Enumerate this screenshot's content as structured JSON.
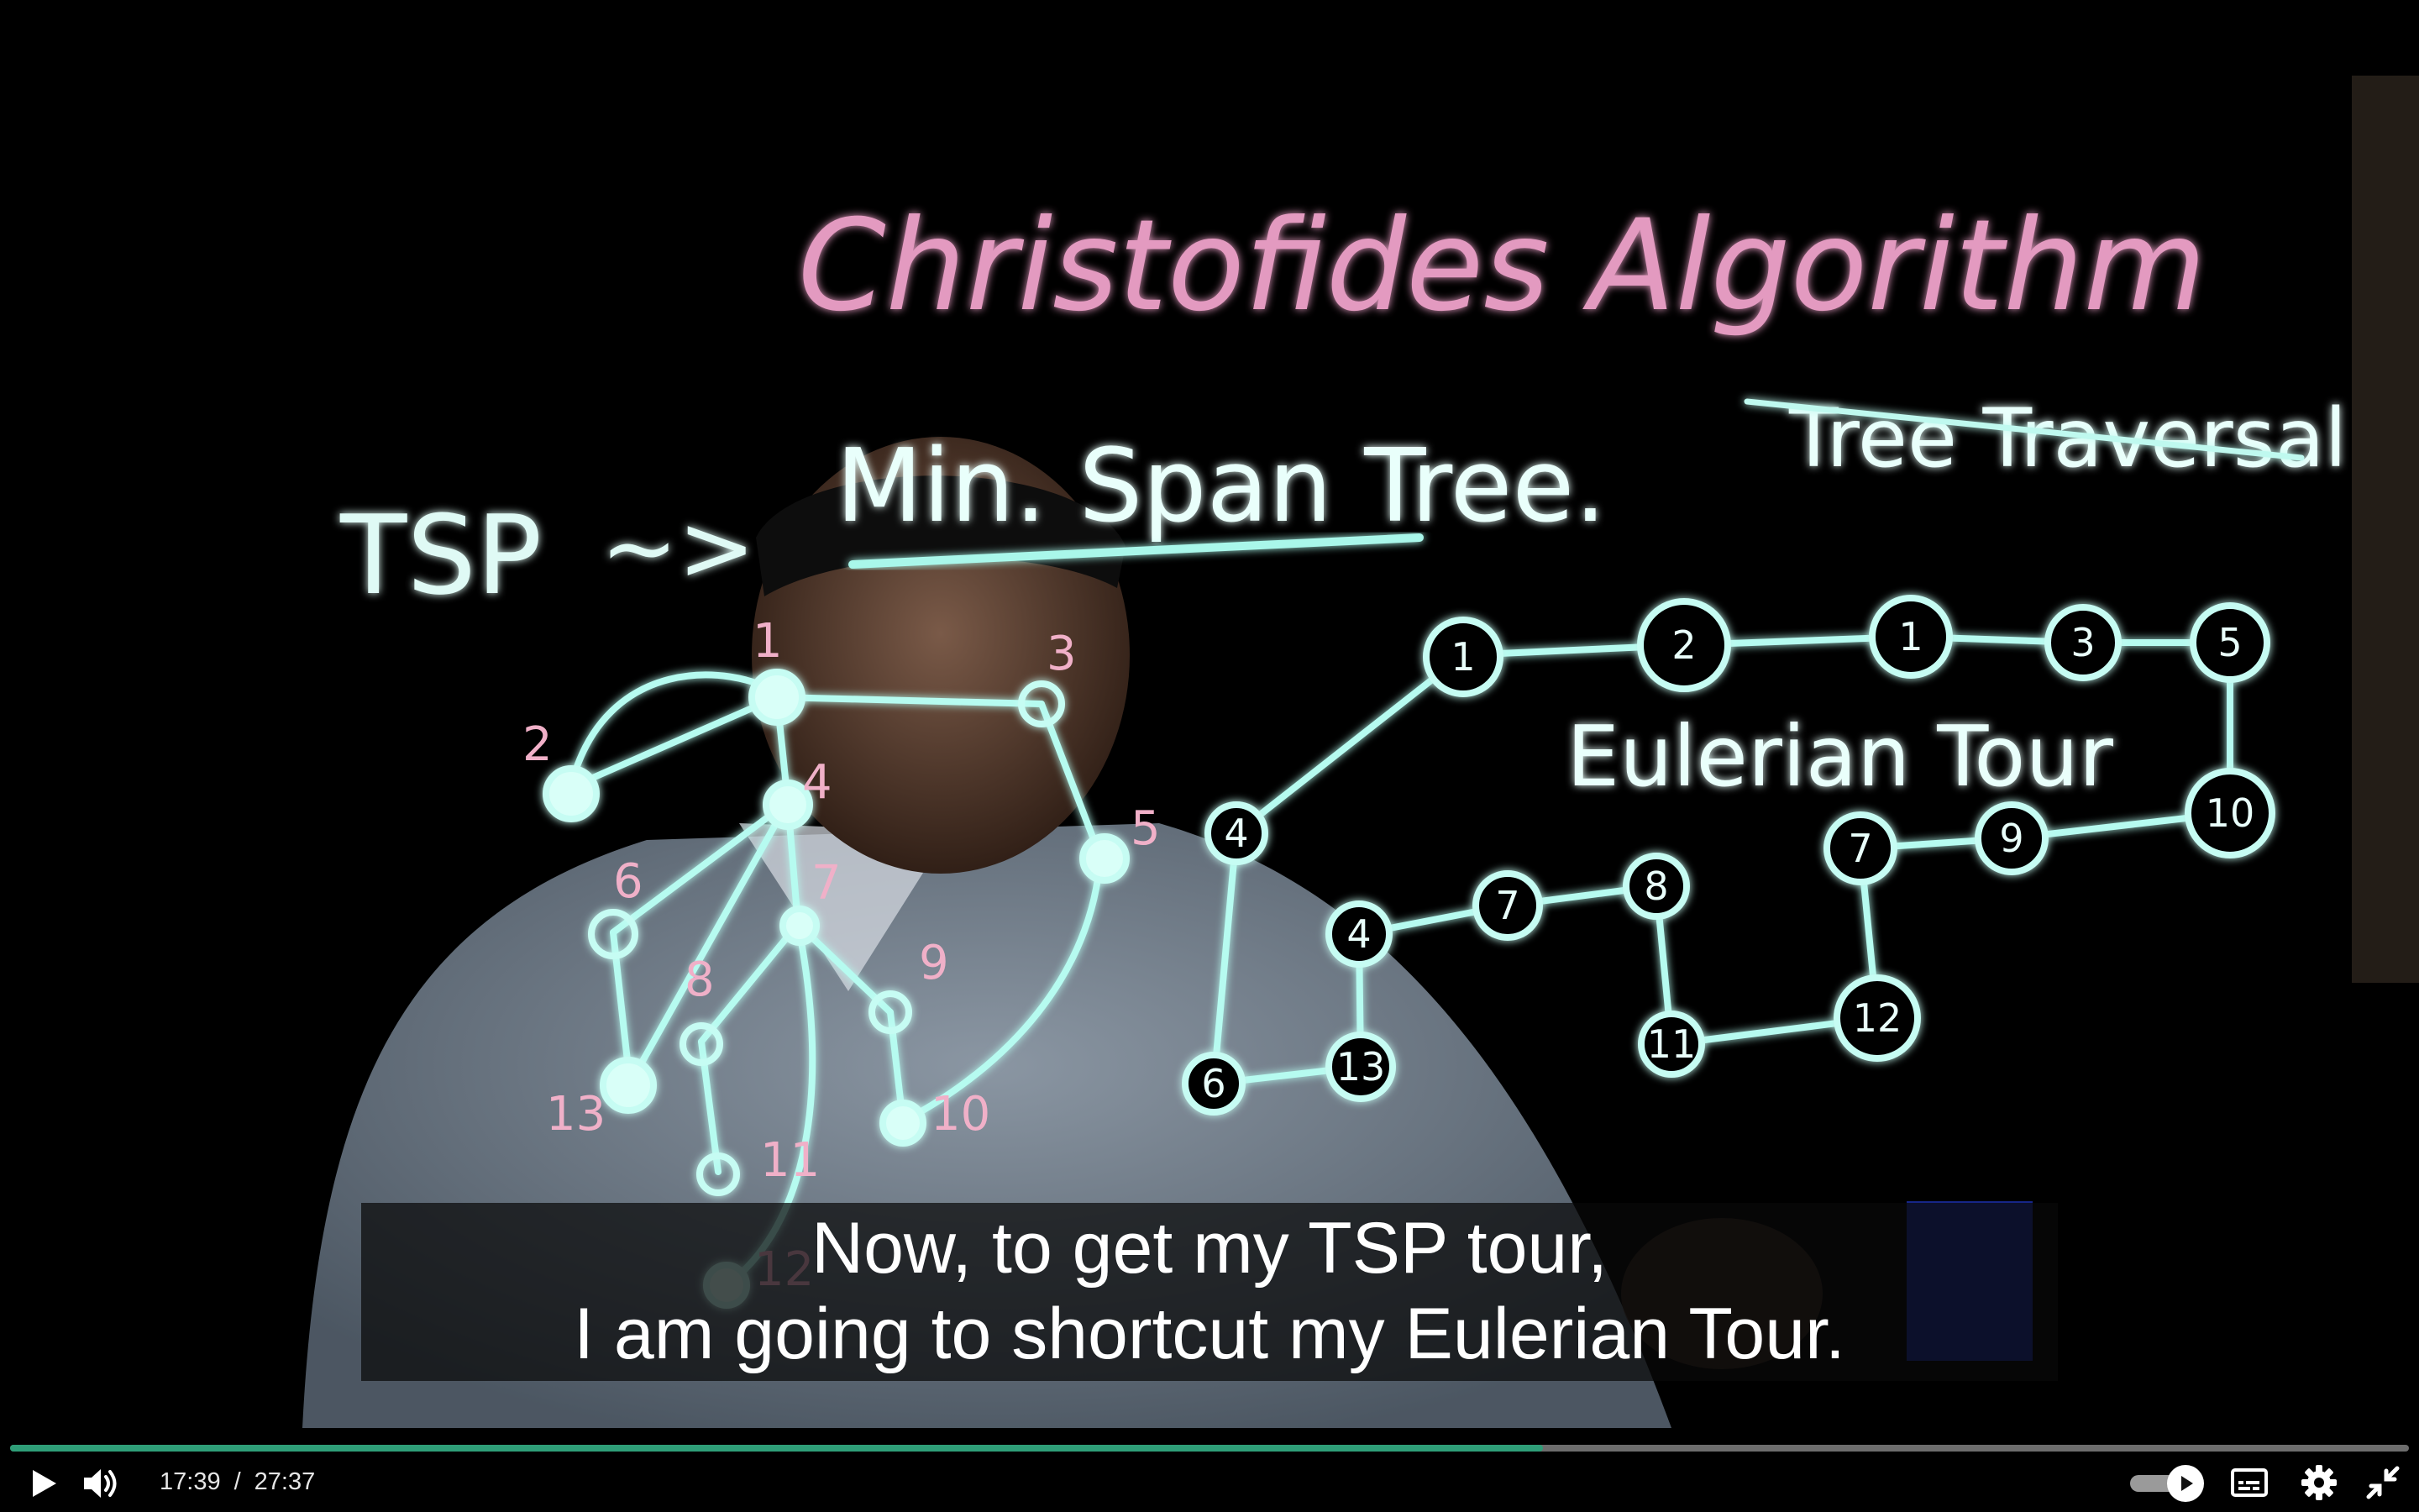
{
  "board": {
    "title": "Christofides Algorithm",
    "tsp_label": "TSP",
    "arrow_symbol": "~>",
    "mst_label": "Min. Span Tree.",
    "traversal_label": "Tree Traversal",
    "euler_label": "Eulerian Tour"
  },
  "mst_node_labels": [
    "1",
    "2",
    "3",
    "4",
    "5",
    "6",
    "7",
    "8",
    "9",
    "10",
    "11",
    "12",
    "13"
  ],
  "tour_node_labels": [
    "1",
    "2",
    "1",
    "3",
    "5",
    "10",
    "9",
    "7",
    "12",
    "11",
    "8",
    "7",
    "4",
    "13",
    "6",
    "4"
  ],
  "captions": {
    "line1": "Now, to get my TSP tour,",
    "line2": "I am going to shortcut my Eulerian Tour."
  },
  "player": {
    "current_time": "17:39",
    "separator": "/",
    "duration": "27:37",
    "progress": 0.639,
    "autoplay_on": true,
    "accent_color": "#2f9e78"
  },
  "icons": [
    "play-icon",
    "volume-icon",
    "autoplay-toggle",
    "captions-icon",
    "gear-icon",
    "exit-fullscreen-icon"
  ]
}
